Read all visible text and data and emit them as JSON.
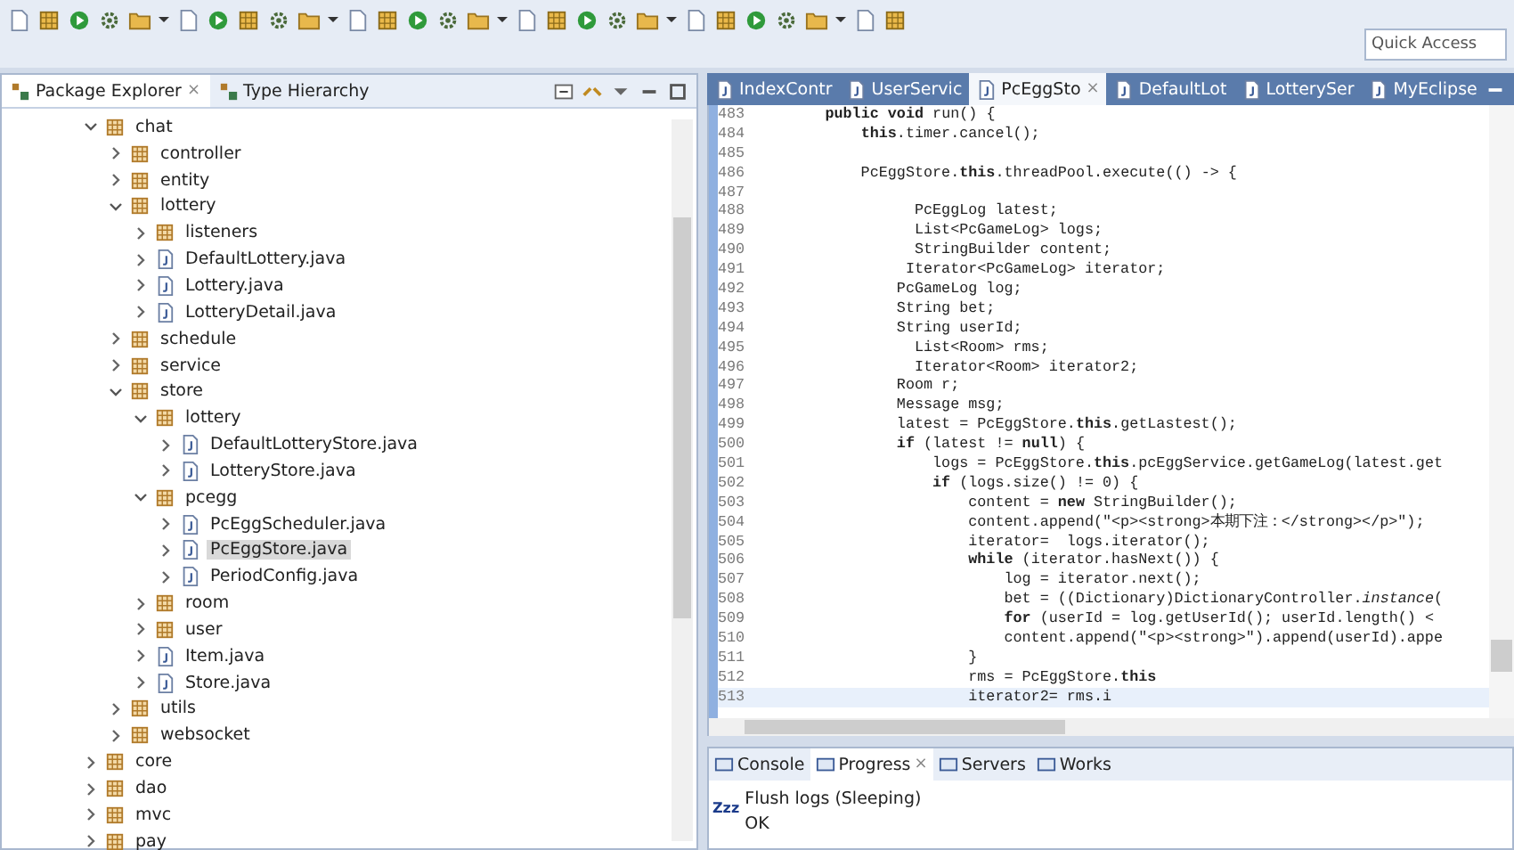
{
  "toolbar": {
    "quick_access": {
      "placeholder": "Quick Access"
    }
  },
  "explorer": {
    "tabs": [
      {
        "label": "Package Explorer",
        "selected": true,
        "close": "×"
      },
      {
        "label": "Type Hierarchy",
        "selected": false
      }
    ],
    "tree": [
      {
        "label": "chat",
        "kind": "package",
        "expanded": true,
        "selected": false,
        "children": [
          {
            "label": "controller",
            "kind": "package",
            "expanded": false,
            "selected": false
          },
          {
            "label": "entity",
            "kind": "package",
            "expanded": false,
            "selected": false
          },
          {
            "label": "lottery",
            "kind": "package",
            "expanded": true,
            "selected": false,
            "children": [
              {
                "label": "listeners",
                "kind": "package",
                "expanded": false,
                "selected": false
              },
              {
                "label": "DefaultLottery.java",
                "kind": "file",
                "expanded": false,
                "selected": false
              },
              {
                "label": "Lottery.java",
                "kind": "file",
                "expanded": false,
                "selected": false
              },
              {
                "label": "LotteryDetail.java",
                "kind": "file",
                "expanded": false,
                "selected": false
              }
            ]
          },
          {
            "label": "schedule",
            "kind": "package",
            "expanded": false,
            "selected": false
          },
          {
            "label": "service",
            "kind": "package",
            "expanded": false,
            "selected": false
          },
          {
            "label": "store",
            "kind": "package",
            "expanded": true,
            "selected": false,
            "children": [
              {
                "label": "lottery",
                "kind": "package",
                "expanded": true,
                "selected": false,
                "children": [
                  {
                    "label": "DefaultLotteryStore.java",
                    "kind": "file",
                    "expanded": false,
                    "selected": false
                  },
                  {
                    "label": "LotteryStore.java",
                    "kind": "file",
                    "expanded": false,
                    "selected": false
                  }
                ]
              },
              {
                "label": "pcegg",
                "kind": "package",
                "expanded": true,
                "selected": false,
                "children": [
                  {
                    "label": "PcEggScheduler.java",
                    "kind": "file",
                    "expanded": false,
                    "selected": false
                  },
                  {
                    "label": "PcEggStore.java",
                    "kind": "file",
                    "expanded": false,
                    "selected": true
                  },
                  {
                    "label": "PeriodConfig.java",
                    "kind": "file",
                    "expanded": false,
                    "selected": false
                  }
                ]
              },
              {
                "label": "room",
                "kind": "package",
                "expanded": false,
                "selected": false
              },
              {
                "label": "user",
                "kind": "package",
                "expanded": false,
                "selected": false
              },
              {
                "label": "Item.java",
                "kind": "file",
                "expanded": false,
                "selected": false
              },
              {
                "label": "Store.java",
                "kind": "file",
                "expanded": false,
                "selected": false
              }
            ]
          },
          {
            "label": "utils",
            "kind": "package",
            "expanded": false,
            "selected": false
          },
          {
            "label": "websocket",
            "kind": "package",
            "expanded": false,
            "selected": false
          }
        ]
      },
      {
        "label": "core",
        "kind": "package",
        "expanded": false,
        "selected": false
      },
      {
        "label": "dao",
        "kind": "package",
        "expanded": false,
        "selected": false
      },
      {
        "label": "mvc",
        "kind": "package",
        "expanded": false,
        "selected": false
      },
      {
        "label": "pay",
        "kind": "package",
        "expanded": false,
        "selected": false
      }
    ]
  },
  "editor": {
    "tabs": [
      {
        "label": "IndexContr",
        "selected": false
      },
      {
        "label": "UserServic",
        "selected": false
      },
      {
        "label": "PcEggSto",
        "selected": true,
        "close": "×"
      },
      {
        "label": "DefaultLot",
        "selected": false
      },
      {
        "label": "LotterySer",
        "selected": false
      },
      {
        "label": "MyEclipse",
        "selected": false
      }
    ],
    "lines": [
      {
        "number": "483",
        "text": "        **public void** run() {",
        "current": false
      },
      {
        "number": "484",
        "text": "            **this**.timer.cancel();",
        "current": false
      },
      {
        "number": "485",
        "current": false
      },
      {
        "number": "486",
        "text": "            PcEggStore.**this**.threadPool.execute(() -> {",
        "current": false
      },
      {
        "number": "487",
        "current": false
      },
      {
        "number": "488",
        "text": "                  PcEggLog latest;",
        "current": false
      },
      {
        "number": "489",
        "text": "                  List<PcGameLog> logs;",
        "current": false
      },
      {
        "number": "490",
        "text": "                  StringBuilder content;",
        "current": false
      },
      {
        "number": "491",
        "text": "                 Iterator<PcGameLog> iterator;",
        "current": false
      },
      {
        "number": "492",
        "text": "                PcGameLog log;",
        "current": false
      },
      {
        "number": "493",
        "text": "                String bet;",
        "current": false
      },
      {
        "number": "494",
        "text": "                String userId;",
        "current": false
      },
      {
        "number": "495",
        "text": "                  List<Room> rms;",
        "current": false
      },
      {
        "number": "496",
        "text": "                  Iterator<Room> iterator2;",
        "current": false
      },
      {
        "number": "497",
        "text": "                Room r;",
        "current": false
      },
      {
        "number": "498",
        "text": "                Message msg;",
        "current": false
      },
      {
        "number": "499",
        "text": "                latest = PcEggStore.**this**.getLastest();",
        "current": false
      },
      {
        "number": "500",
        "text": "                **if** (latest != **null**) {",
        "current": false
      },
      {
        "number": "501",
        "text": "                    logs = PcEggStore.**this**.pcEggService.getGameLog(latest.get",
        "current": false
      },
      {
        "number": "502",
        "text": "                    **if** (logs.size() != 0) {",
        "current": false
      },
      {
        "number": "503",
        "text": "                        content = **new** StringBuilder();",
        "current": false
      },
      {
        "number": "504",
        "text": "                        content.append(\"<p><strong>本期下注：</strong></p>\");",
        "current": false
      },
      {
        "number": "505",
        "text": "                        iterator=  logs.iterator();",
        "current": false
      },
      {
        "number": "506",
        "text": "                        **while** (iterator.hasNext()) {",
        "current": false
      },
      {
        "number": "507",
        "text": "                            log = iterator.next();",
        "current": false
      },
      {
        "number": "508",
        "text": "                            bet = ((Dictionary)DictionaryController.*instance*(",
        "current": false
      },
      {
        "number": "509",
        "text": "                            **for** (userId = log.getUserId(); userId.length() <",
        "current": false
      },
      {
        "number": "510",
        "text": "                            content.append(\"<p><strong>\").append(userId).appe",
        "current": false
      },
      {
        "number": "511",
        "text": "                        }",
        "current": false
      },
      {
        "number": "512",
        "text": "                        rms = PcEggStore.**this**",
        "current": false
      },
      {
        "number": "513",
        "text": "                        iterator2= rms.i",
        "current": true
      }
    ]
  },
  "bottom": {
    "tabs": [
      {
        "label": "Console",
        "selected": false
      },
      {
        "label": "Progress",
        "selected": true,
        "close": "×"
      },
      {
        "label": "Servers",
        "selected": false
      },
      {
        "label": "Works",
        "selected": false
      }
    ],
    "progress": {
      "icon_text": "Zzz",
      "task": "Flush logs (Sleeping)",
      "status": "OK"
    }
  }
}
